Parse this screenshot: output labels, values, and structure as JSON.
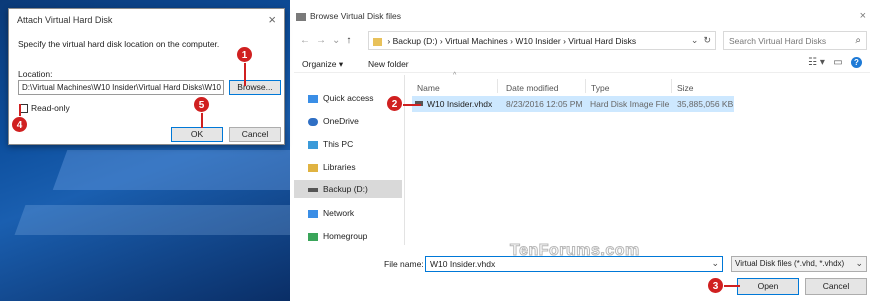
{
  "attach_dialog": {
    "title": "Attach Virtual Hard Disk",
    "close": "×",
    "description": "Specify the virtual hard disk location on the computer.",
    "location_label": "Location:",
    "location_value": "D:\\Virtual Machines\\W10 Insider\\Virtual Hard Disks\\W10",
    "browse_label": "Browse...",
    "readonly_label": "Read-only",
    "readonly_checked": false,
    "ok_label": "OK",
    "cancel_label": "Cancel"
  },
  "browse_dialog": {
    "title": "Browse Virtual Disk files",
    "close": "×",
    "nav_back": "←",
    "nav_forward": "→",
    "nav_recent": "⌄",
    "nav_up": "↑",
    "address": {
      "segments": [
        "Backup (D:)",
        "Virtual Machines",
        "W10 Insider",
        "Virtual Hard Disks"
      ],
      "separator": "›",
      "dropdown": "⌄",
      "refresh": "↻"
    },
    "search_placeholder": "Search Virtual Hard Disks",
    "search_icon": "⌕",
    "organize_label": "Organize ▾",
    "new_folder_label": "New folder",
    "view_icon": "☷ ▾",
    "preview_icon": "▭",
    "help_icon": "?",
    "nav_items": [
      {
        "label": "Quick access",
        "icon": "star-icon",
        "color": "#3a8ee6"
      },
      {
        "label": "OneDrive",
        "icon": "cloud-icon",
        "color": "#2f6fc4"
      },
      {
        "label": "This PC",
        "icon": "computer-icon",
        "color": "#3a9ad9"
      },
      {
        "label": "Libraries",
        "icon": "library-icon",
        "color": "#e0b341"
      },
      {
        "label": "Backup (D:)",
        "icon": "drive-icon",
        "color": "#555555",
        "selected": true
      },
      {
        "label": "Network",
        "icon": "network-icon",
        "color": "#3a8ee6"
      },
      {
        "label": "Homegroup",
        "icon": "homegroup-icon",
        "color": "#3aa55a"
      }
    ],
    "columns": [
      "Name",
      "Date modified",
      "Type",
      "Size"
    ],
    "sort_caret": "^",
    "files": [
      {
        "name": "W10 Insider.vhdx",
        "date": "8/23/2016 12:05 PM",
        "type": "Hard Disk Image File",
        "size": "35,885,056 KB"
      }
    ],
    "filename_label": "File name:",
    "filename_value": "W10 Insider.vhdx",
    "filetype_value": "Virtual Disk files (*.vhd, *.vhdx)",
    "dropdown_glyph": "⌄",
    "open_label": "Open",
    "cancel_label": "Cancel"
  },
  "watermark": "TenForums.com",
  "steps": [
    "1",
    "2",
    "3",
    "4",
    "5"
  ],
  "accent_color": "#0078d7",
  "step_color": "#d02020"
}
